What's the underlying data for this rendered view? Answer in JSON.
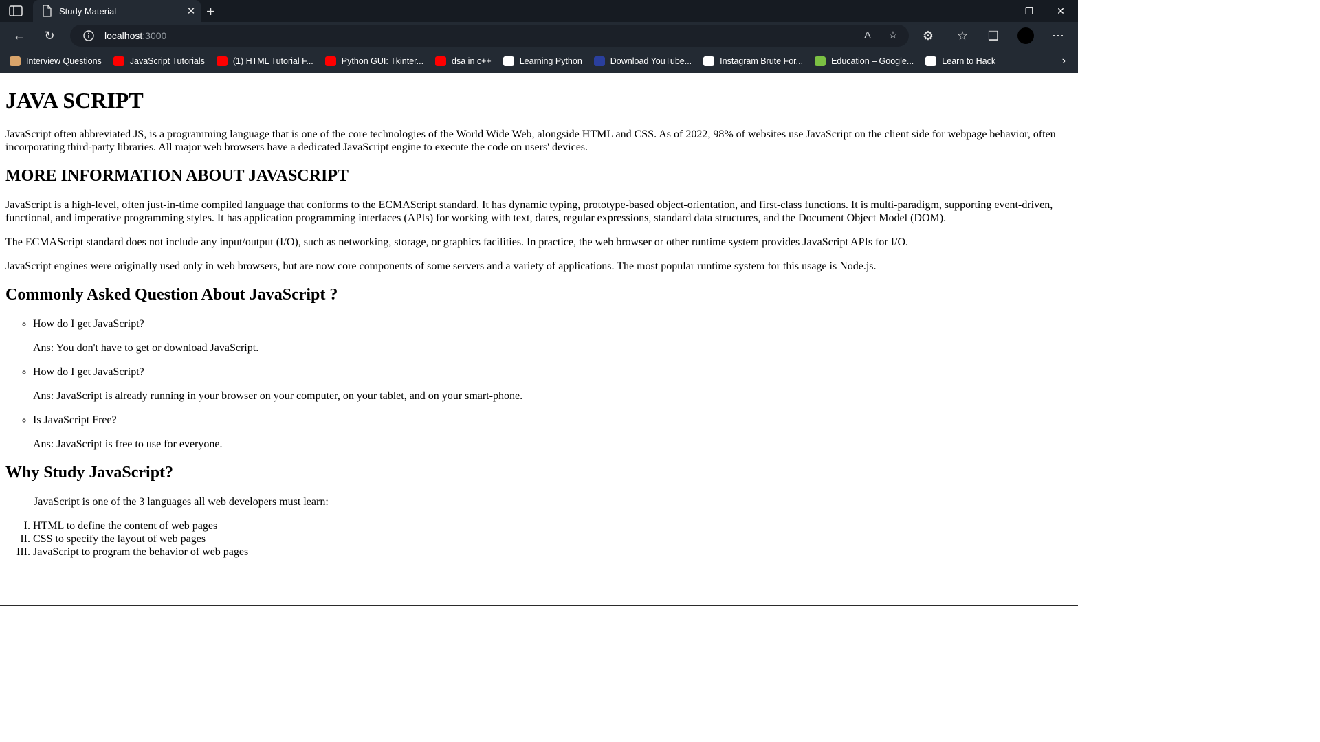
{
  "browser": {
    "tab_title": "Study Material",
    "new_tab_symbol": "+",
    "url_host": "localhost",
    "url_port": ":3000",
    "bookmarks": [
      {
        "label": "Interview Questions",
        "color": "#d9a46b"
      },
      {
        "label": "JavaScript Tutorials",
        "color": "#ff0000"
      },
      {
        "label": "(1) HTML Tutorial F...",
        "color": "#ff0000"
      },
      {
        "label": "Python GUI: Tkinter...",
        "color": "#ff0000"
      },
      {
        "label": "dsa in c++",
        "color": "#ff0000"
      },
      {
        "label": "Learning Python",
        "color": "#ffffff"
      },
      {
        "label": "Download YouTube...",
        "color": "#2a3f9e"
      },
      {
        "label": "Instagram Brute For...",
        "color": "#ffffff"
      },
      {
        "label": "Education – Google...",
        "color": "#7bc043"
      },
      {
        "label": "Learn to Hack",
        "color": "#ffffff"
      }
    ]
  },
  "page": {
    "title": "JAVA SCRIPT",
    "intro": "JavaScript often abbreviated JS, is a programming language that is one of the core technologies of the World Wide Web, alongside HTML and CSS. As of 2022, 98% of websites use JavaScript on the client side for webpage behavior, often incorporating third-party libraries. All major web browsers have a dedicated JavaScript engine to execute the code on users' devices.",
    "more_heading": "MORE INFORMATION ABOUT JAVASCRIPT",
    "more_paragraphs": [
      "JavaScript is a high-level, often just-in-time compiled language that conforms to the ECMAScript standard. It has dynamic typing, prototype-based object-orientation, and first-class functions. It is multi-paradigm, supporting event-driven, functional, and imperative programming styles. It has application programming interfaces (APIs) for working with text, dates, regular expressions, standard data structures, and the Document Object Model (DOM).",
      "The ECMAScript standard does not include any input/output (I/O), such as networking, storage, or graphics facilities. In practice, the web browser or other runtime system provides JavaScript APIs for I/O.",
      "JavaScript engines were originally used only in web browsers, but are now core components of some servers and a variety of applications. The most popular runtime system for this usage is Node.js."
    ],
    "faq_heading": "Commonly Asked Question About JavaScript ?",
    "faq": [
      {
        "q": "How do I get JavaScript?",
        "a": "Ans: You don't have to get or download JavaScript."
      },
      {
        "q": "How do I get JavaScript?",
        "a": "Ans: JavaScript is already running in your browser on your computer, on your tablet, and on your smart-phone."
      },
      {
        "q": "Is JavaScript Free?",
        "a": "Ans: JavaScript is free to use for everyone."
      }
    ],
    "why_heading": "Why Study JavaScript?",
    "why_intro": "JavaScript is one of the 3 languages all web developers must learn:",
    "languages": [
      "HTML to define the content of web pages",
      "CSS to specify the layout of web pages",
      "JavaScript to program the behavior of web pages"
    ]
  }
}
